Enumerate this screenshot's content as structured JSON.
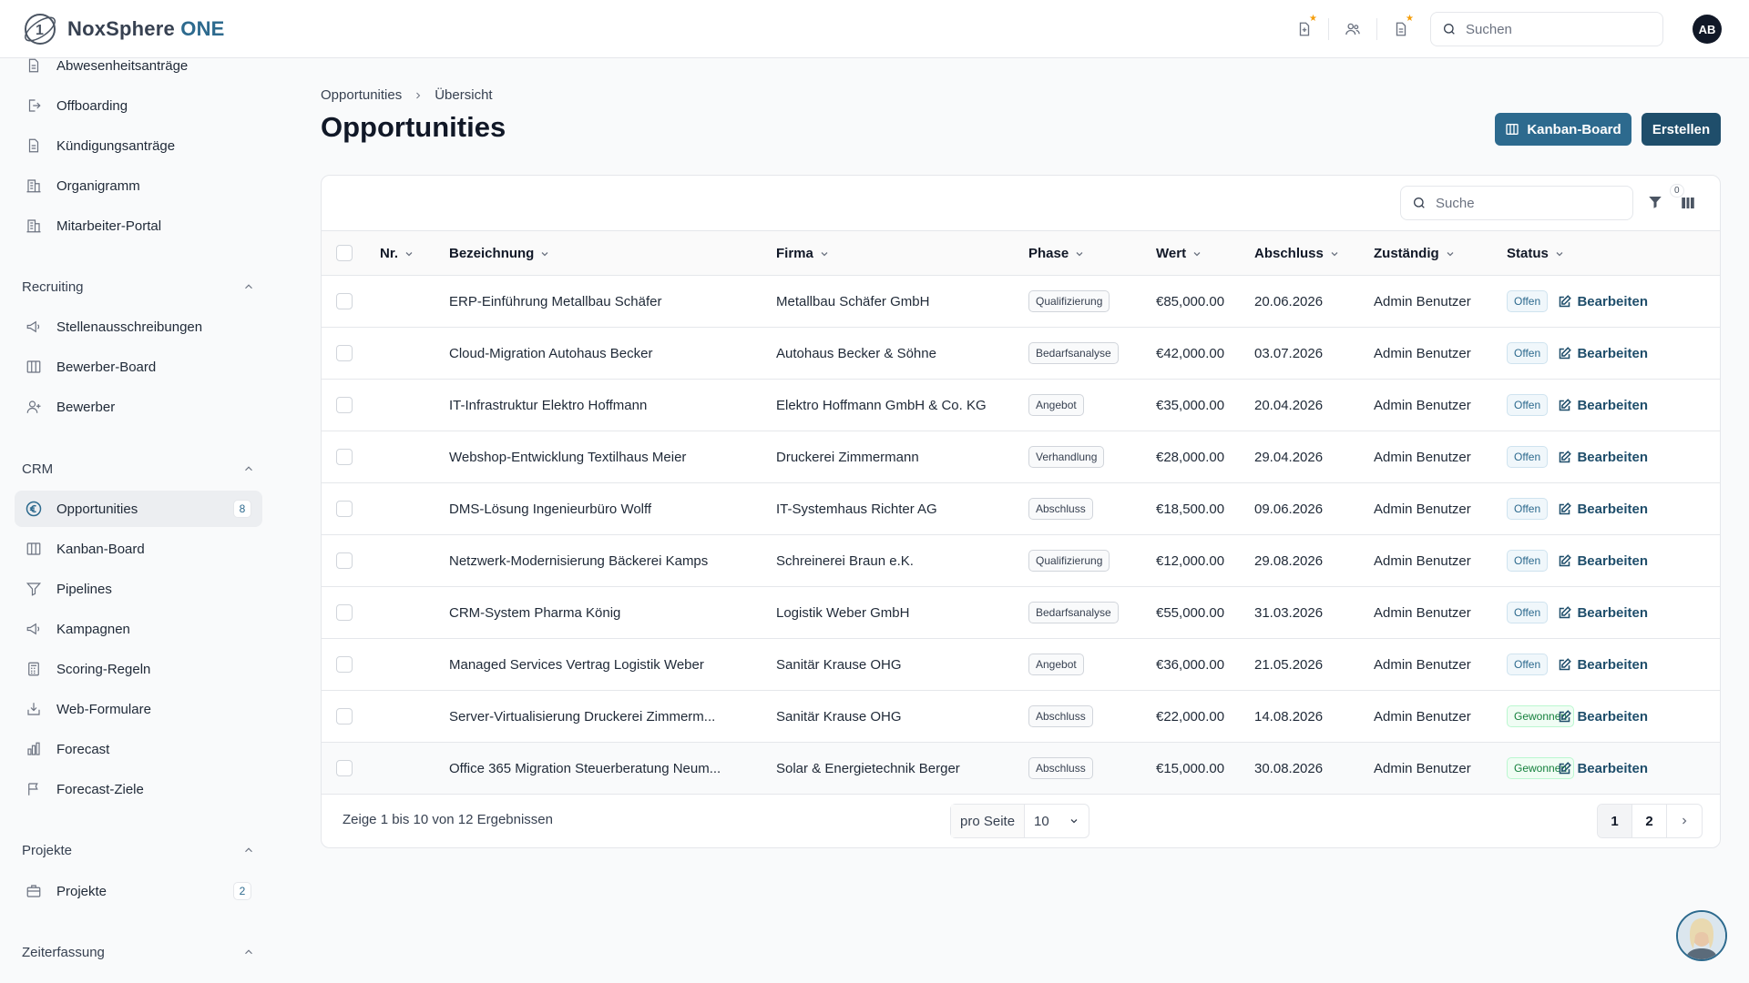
{
  "app": {
    "brand_name": "NoxSphere",
    "brand_suffix": "ONE",
    "search_placeholder": "Suchen",
    "user_initials": "AB"
  },
  "colors": {
    "primary": "#2d6a8e",
    "primary_dark": "#1f4e6b",
    "star": "#f59e0b",
    "won": "#15803d"
  },
  "sidebar": {
    "hr_items": [
      {
        "label": "Abwesenheitsanträge",
        "icon": "document-icon"
      },
      {
        "label": "Offboarding",
        "icon": "exit-icon"
      },
      {
        "label": "Kündigungsanträge",
        "icon": "document-icon"
      },
      {
        "label": "Organigramm",
        "icon": "building-icon"
      },
      {
        "label": "Mitarbeiter-Portal",
        "icon": "building-icon"
      }
    ],
    "sections": {
      "recruiting": "Recruiting",
      "crm": "CRM",
      "projects": "Projekte",
      "time": "Zeiterfassung"
    },
    "recruiting_items": [
      {
        "label": "Stellenausschreibungen",
        "icon": "megaphone-icon"
      },
      {
        "label": "Bewerber-Board",
        "icon": "columns-icon"
      },
      {
        "label": "Bewerber",
        "icon": "user-plus-icon"
      }
    ],
    "crm_items": [
      {
        "label": "Opportunities",
        "icon": "euro-icon",
        "badge": "8"
      },
      {
        "label": "Kanban-Board",
        "icon": "columns-icon"
      },
      {
        "label": "Pipelines",
        "icon": "funnel-icon"
      },
      {
        "label": "Kampagnen",
        "icon": "megaphone-icon"
      },
      {
        "label": "Scoring-Regeln",
        "icon": "calculator-icon"
      },
      {
        "label": "Web-Formulare",
        "icon": "inbox-icon"
      },
      {
        "label": "Forecast",
        "icon": "bar-chart-icon"
      },
      {
        "label": "Forecast-Ziele",
        "icon": "flag-icon"
      }
    ],
    "project_items": [
      {
        "label": "Projekte",
        "icon": "briefcase-icon",
        "badge": "2"
      }
    ]
  },
  "breadcrumb": {
    "parent": "Opportunities",
    "current": "Übersicht"
  },
  "page": {
    "title": "Opportunities",
    "kanban_button": "Kanban-Board",
    "create_button": "Erstellen"
  },
  "table": {
    "search_placeholder": "Suche",
    "filter_count": "0",
    "columns": {
      "nr": "Nr.",
      "name": "Bezeichnung",
      "company": "Firma",
      "phase": "Phase",
      "value": "Wert",
      "close": "Abschluss",
      "owner": "Zuständig",
      "status": "Status"
    },
    "edit_label": "Bearbeiten",
    "rows": [
      {
        "nr": "",
        "name": "ERP-Einführung Metallbau Schäfer",
        "company": "Metallbau Schäfer GmbH",
        "phase": "Qualifizierung",
        "value": "€85,000.00",
        "close": "20.06.2026",
        "owner": "Admin Benutzer",
        "status": "Offen"
      },
      {
        "nr": "",
        "name": "Cloud-Migration Autohaus Becker",
        "company": "Autohaus Becker & Söhne",
        "phase": "Bedarfsanalyse",
        "value": "€42,000.00",
        "close": "03.07.2026",
        "owner": "Admin Benutzer",
        "status": "Offen"
      },
      {
        "nr": "",
        "name": "IT-Infrastruktur Elektro Hoffmann",
        "company": "Elektro Hoffmann GmbH & Co. KG",
        "phase": "Angebot",
        "value": "€35,000.00",
        "close": "20.04.2026",
        "owner": "Admin Benutzer",
        "status": "Offen"
      },
      {
        "nr": "",
        "name": "Webshop-Entwicklung Textilhaus Meier",
        "company": "Druckerei Zimmermann",
        "phase": "Verhandlung",
        "value": "€28,000.00",
        "close": "29.04.2026",
        "owner": "Admin Benutzer",
        "status": "Offen"
      },
      {
        "nr": "",
        "name": "DMS-Lösung Ingenieurbüro Wolff",
        "company": "IT-Systemhaus Richter AG",
        "phase": "Abschluss",
        "value": "€18,500.00",
        "close": "09.06.2026",
        "owner": "Admin Benutzer",
        "status": "Offen"
      },
      {
        "nr": "",
        "name": "Netzwerk-Modernisierung Bäckerei Kamps",
        "company": "Schreinerei Braun e.K.",
        "phase": "Qualifizierung",
        "value": "€12,000.00",
        "close": "29.08.2026",
        "owner": "Admin Benutzer",
        "status": "Offen"
      },
      {
        "nr": "",
        "name": "CRM-System Pharma König",
        "company": "Logistik Weber GmbH",
        "phase": "Bedarfsanalyse",
        "value": "€55,000.00",
        "close": "31.03.2026",
        "owner": "Admin Benutzer",
        "status": "Offen"
      },
      {
        "nr": "",
        "name": "Managed Services Vertrag Logistik Weber",
        "company": "Sanitär Krause OHG",
        "phase": "Angebot",
        "value": "€36,000.00",
        "close": "21.05.2026",
        "owner": "Admin Benutzer",
        "status": "Offen"
      },
      {
        "nr": "",
        "name": "Server-Virtualisierung Druckerei Zimmerm...",
        "company": "Sanitär Krause OHG",
        "phase": "Abschluss",
        "value": "€22,000.00",
        "close": "14.08.2026",
        "owner": "Admin Benutzer",
        "status": "Gewonnen"
      },
      {
        "nr": "",
        "name": "Office 365 Migration Steuerberatung Neum...",
        "company": "Solar & Energietechnik Berger",
        "phase": "Abschluss",
        "value": "€15,000.00",
        "close": "30.08.2026",
        "owner": "Admin Benutzer",
        "status": "Gewonnen"
      }
    ]
  },
  "pagination": {
    "summary": "Zeige 1 bis 10 von 12 Ergebnissen",
    "per_page_label": "pro Seite",
    "per_page_value": "10",
    "pages": [
      "1",
      "2"
    ],
    "current_page": "1"
  }
}
